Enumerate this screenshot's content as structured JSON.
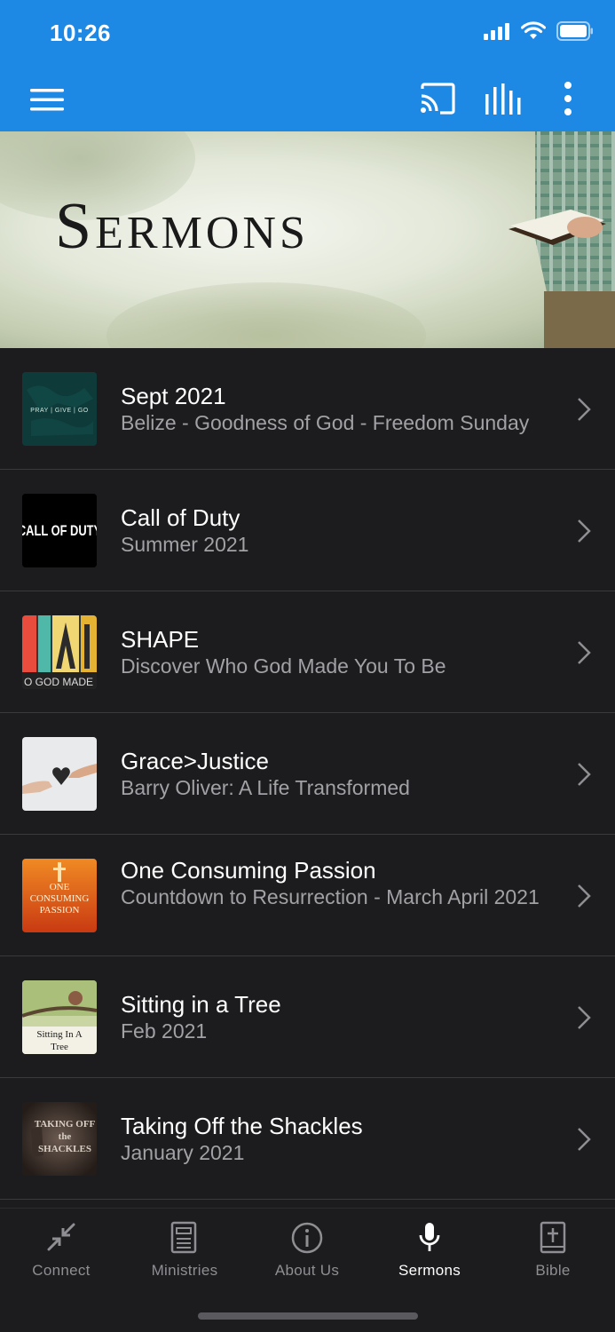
{
  "status_bar": {
    "time": "10:26"
  },
  "colors": {
    "primary": "#1e88e5",
    "background": "#1c1c1e",
    "subtitle": "#a1a1a6",
    "tab_inactive": "#8e8e93",
    "tab_active": "#ffffff"
  },
  "app_bar": {
    "icons": [
      "menu-icon",
      "cast-icon",
      "equalizer-icon",
      "more-vert-icon"
    ]
  },
  "banner": {
    "title": "Sermons"
  },
  "sermons": [
    {
      "title": "Sept 2021",
      "subtitle": "Belize - Goodness of God  - Freedom Sunday",
      "thumb_text": "PRAY | GIVE | GO"
    },
    {
      "title": "Call of Duty",
      "subtitle": "Summer 2021",
      "thumb_text": "CALL OF DUTY"
    },
    {
      "title": "SHAPE",
      "subtitle": "Discover Who God Made You To Be",
      "thumb_text": "O GOD MADE"
    },
    {
      "title": "Grace>Justice",
      "subtitle": "Barry Oliver: A Life Transformed",
      "thumb_text": ""
    },
    {
      "title": "One Consuming Passion",
      "subtitle": "Countdown to Resurrection - March April 2021",
      "thumb_text": "ONE CONSUMING PASSION"
    },
    {
      "title": "Sitting in a Tree",
      "subtitle": "Feb 2021",
      "thumb_text": "Sitting In A Tree"
    },
    {
      "title": "Taking Off the Shackles",
      "subtitle": "January 2021",
      "thumb_text": "TAKING OFF the SHACKLES"
    }
  ],
  "tabs": [
    {
      "label": "Connect",
      "icon": "connect-icon"
    },
    {
      "label": "Ministries",
      "icon": "ministries-icon"
    },
    {
      "label": "About Us",
      "icon": "info-icon"
    },
    {
      "label": "Sermons",
      "icon": "microphone-icon",
      "active": true
    },
    {
      "label": "Bible",
      "icon": "bible-icon"
    }
  ]
}
